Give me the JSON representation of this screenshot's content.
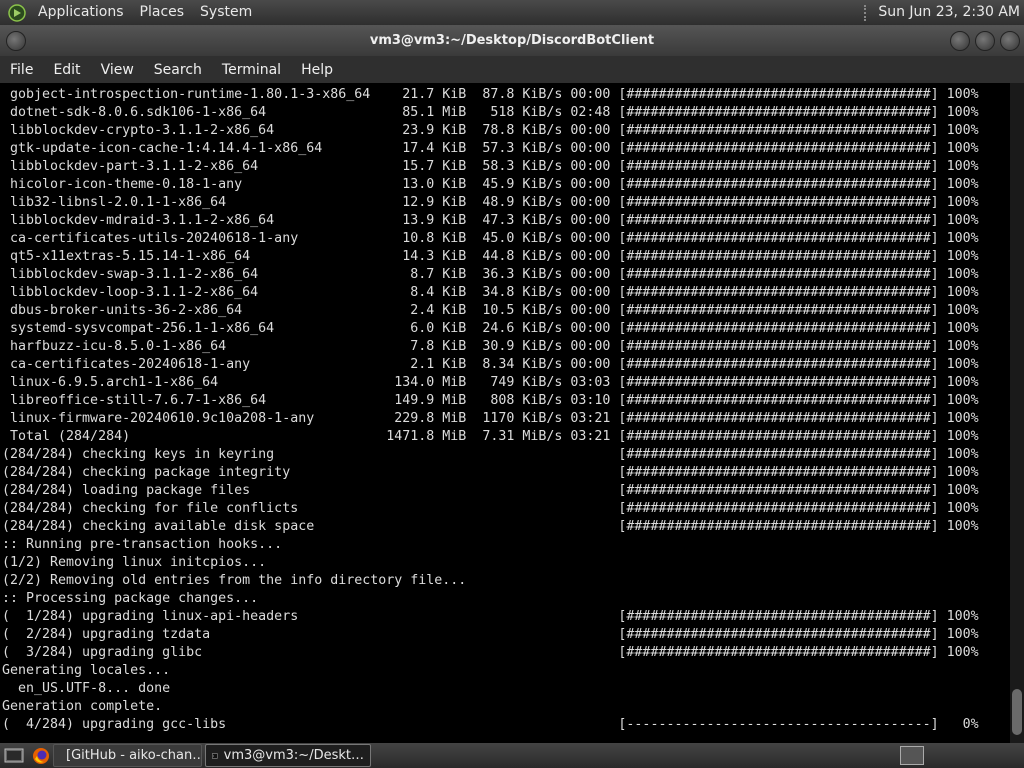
{
  "top_panel": {
    "menus": [
      "Applications",
      "Places",
      "System"
    ],
    "clock": "Sun Jun 23,  2:30 AM"
  },
  "window": {
    "title": "vm3@vm3:~/Desktop/DiscordBotClient"
  },
  "menubar": {
    "items": [
      "File",
      "Edit",
      "View",
      "Search",
      "Terminal",
      "Help"
    ]
  },
  "terminal": {
    "lines": [
      " gobject-introspection-runtime-1.80.1-3-x86_64    21.7 KiB  87.8 KiB/s 00:00 [######################################] 100%",
      " dotnet-sdk-8.0.6.sdk106-1-x86_64                 85.1 MiB   518 KiB/s 02:48 [######################################] 100%",
      " libblockdev-crypto-3.1.1-2-x86_64                23.9 KiB  78.8 KiB/s 00:00 [######################################] 100%",
      " gtk-update-icon-cache-1:4.14.4-1-x86_64          17.4 KiB  57.3 KiB/s 00:00 [######################################] 100%",
      " libblockdev-part-3.1.1-2-x86_64                  15.7 KiB  58.3 KiB/s 00:00 [######################################] 100%",
      " hicolor-icon-theme-0.18-1-any                    13.0 KiB  45.9 KiB/s 00:00 [######################################] 100%",
      " lib32-libnsl-2.0.1-1-x86_64                      12.9 KiB  48.9 KiB/s 00:00 [######################################] 100%",
      " libblockdev-mdraid-3.1.1-2-x86_64                13.9 KiB  47.3 KiB/s 00:00 [######################################] 100%",
      " ca-certificates-utils-20240618-1-any             10.8 KiB  45.0 KiB/s 00:00 [######################################] 100%",
      " qt5-x11extras-5.15.14-1-x86_64                   14.3 KiB  44.8 KiB/s 00:00 [######################################] 100%",
      " libblockdev-swap-3.1.1-2-x86_64                   8.7 KiB  36.3 KiB/s 00:00 [######################################] 100%",
      " libblockdev-loop-3.1.1-2-x86_64                   8.4 KiB  34.8 KiB/s 00:00 [######################################] 100%",
      " dbus-broker-units-36-2-x86_64                     2.4 KiB  10.5 KiB/s 00:00 [######################################] 100%",
      " systemd-sysvcompat-256.1-1-x86_64                 6.0 KiB  24.6 KiB/s 00:00 [######################################] 100%",
      " harfbuzz-icu-8.5.0-1-x86_64                       7.8 KiB  30.9 KiB/s 00:00 [######################################] 100%",
      " ca-certificates-20240618-1-any                    2.1 KiB  8.34 KiB/s 00:00 [######################################] 100%",
      " linux-6.9.5.arch1-1-x86_64                      134.0 MiB   749 KiB/s 03:03 [######################################] 100%",
      " libreoffice-still-7.6.7-1-x86_64                149.9 MiB   808 KiB/s 03:10 [######################################] 100%",
      " linux-firmware-20240610.9c10a208-1-any          229.8 MiB  1170 KiB/s 03:21 [######################################] 100%",
      " Total (284/284)                                1471.8 MiB  7.31 MiB/s 03:21 [######################################] 100%",
      "(284/284) checking keys in keyring                                           [######################################] 100%",
      "(284/284) checking package integrity                                         [######################################] 100%",
      "(284/284) loading package files                                              [######################################] 100%",
      "(284/284) checking for file conflicts                                        [######################################] 100%",
      "(284/284) checking available disk space                                      [######################################] 100%",
      ":: Running pre-transaction hooks...",
      "(1/2) Removing linux initcpios...",
      "(2/2) Removing old entries from the info directory file...",
      ":: Processing package changes...",
      "(  1/284) upgrading linux-api-headers                                        [######################################] 100%",
      "(  2/284) upgrading tzdata                                                   [######################################] 100%",
      "(  3/284) upgrading glibc                                                    [######################################] 100%",
      "Generating locales...",
      "  en_US.UTF-8... done",
      "Generation complete.",
      "(  4/284) upgrading gcc-libs                                                 [--------------------------------------]   0%"
    ]
  },
  "taskbar": {
    "tasks": [
      "[GitHub - aiko-chan…",
      "vm3@vm3:~/Deskt…"
    ]
  },
  "colors": {
    "terminal_bg": "#000000",
    "terminal_fg": "#dcdcdc",
    "panel_bg": "#3a3a3a"
  }
}
